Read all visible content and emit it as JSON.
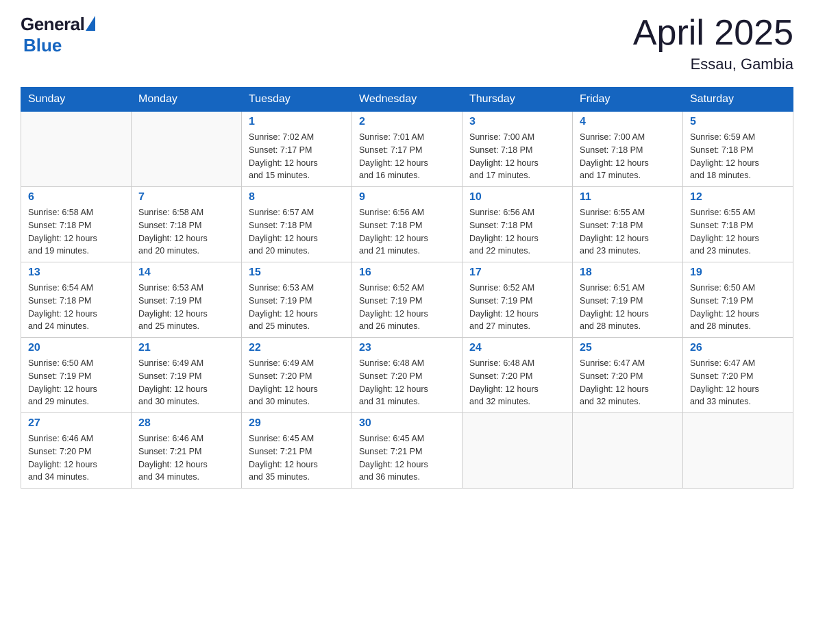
{
  "header": {
    "logo_general": "General",
    "logo_blue": "Blue",
    "month_title": "April 2025",
    "location": "Essau, Gambia"
  },
  "weekdays": [
    "Sunday",
    "Monday",
    "Tuesday",
    "Wednesday",
    "Thursday",
    "Friday",
    "Saturday"
  ],
  "weeks": [
    [
      {
        "day": "",
        "info": ""
      },
      {
        "day": "",
        "info": ""
      },
      {
        "day": "1",
        "info": "Sunrise: 7:02 AM\nSunset: 7:17 PM\nDaylight: 12 hours\nand 15 minutes."
      },
      {
        "day": "2",
        "info": "Sunrise: 7:01 AM\nSunset: 7:17 PM\nDaylight: 12 hours\nand 16 minutes."
      },
      {
        "day": "3",
        "info": "Sunrise: 7:00 AM\nSunset: 7:18 PM\nDaylight: 12 hours\nand 17 minutes."
      },
      {
        "day": "4",
        "info": "Sunrise: 7:00 AM\nSunset: 7:18 PM\nDaylight: 12 hours\nand 17 minutes."
      },
      {
        "day": "5",
        "info": "Sunrise: 6:59 AM\nSunset: 7:18 PM\nDaylight: 12 hours\nand 18 minutes."
      }
    ],
    [
      {
        "day": "6",
        "info": "Sunrise: 6:58 AM\nSunset: 7:18 PM\nDaylight: 12 hours\nand 19 minutes."
      },
      {
        "day": "7",
        "info": "Sunrise: 6:58 AM\nSunset: 7:18 PM\nDaylight: 12 hours\nand 20 minutes."
      },
      {
        "day": "8",
        "info": "Sunrise: 6:57 AM\nSunset: 7:18 PM\nDaylight: 12 hours\nand 20 minutes."
      },
      {
        "day": "9",
        "info": "Sunrise: 6:56 AM\nSunset: 7:18 PM\nDaylight: 12 hours\nand 21 minutes."
      },
      {
        "day": "10",
        "info": "Sunrise: 6:56 AM\nSunset: 7:18 PM\nDaylight: 12 hours\nand 22 minutes."
      },
      {
        "day": "11",
        "info": "Sunrise: 6:55 AM\nSunset: 7:18 PM\nDaylight: 12 hours\nand 23 minutes."
      },
      {
        "day": "12",
        "info": "Sunrise: 6:55 AM\nSunset: 7:18 PM\nDaylight: 12 hours\nand 23 minutes."
      }
    ],
    [
      {
        "day": "13",
        "info": "Sunrise: 6:54 AM\nSunset: 7:18 PM\nDaylight: 12 hours\nand 24 minutes."
      },
      {
        "day": "14",
        "info": "Sunrise: 6:53 AM\nSunset: 7:19 PM\nDaylight: 12 hours\nand 25 minutes."
      },
      {
        "day": "15",
        "info": "Sunrise: 6:53 AM\nSunset: 7:19 PM\nDaylight: 12 hours\nand 25 minutes."
      },
      {
        "day": "16",
        "info": "Sunrise: 6:52 AM\nSunset: 7:19 PM\nDaylight: 12 hours\nand 26 minutes."
      },
      {
        "day": "17",
        "info": "Sunrise: 6:52 AM\nSunset: 7:19 PM\nDaylight: 12 hours\nand 27 minutes."
      },
      {
        "day": "18",
        "info": "Sunrise: 6:51 AM\nSunset: 7:19 PM\nDaylight: 12 hours\nand 28 minutes."
      },
      {
        "day": "19",
        "info": "Sunrise: 6:50 AM\nSunset: 7:19 PM\nDaylight: 12 hours\nand 28 minutes."
      }
    ],
    [
      {
        "day": "20",
        "info": "Sunrise: 6:50 AM\nSunset: 7:19 PM\nDaylight: 12 hours\nand 29 minutes."
      },
      {
        "day": "21",
        "info": "Sunrise: 6:49 AM\nSunset: 7:19 PM\nDaylight: 12 hours\nand 30 minutes."
      },
      {
        "day": "22",
        "info": "Sunrise: 6:49 AM\nSunset: 7:20 PM\nDaylight: 12 hours\nand 30 minutes."
      },
      {
        "day": "23",
        "info": "Sunrise: 6:48 AM\nSunset: 7:20 PM\nDaylight: 12 hours\nand 31 minutes."
      },
      {
        "day": "24",
        "info": "Sunrise: 6:48 AM\nSunset: 7:20 PM\nDaylight: 12 hours\nand 32 minutes."
      },
      {
        "day": "25",
        "info": "Sunrise: 6:47 AM\nSunset: 7:20 PM\nDaylight: 12 hours\nand 32 minutes."
      },
      {
        "day": "26",
        "info": "Sunrise: 6:47 AM\nSunset: 7:20 PM\nDaylight: 12 hours\nand 33 minutes."
      }
    ],
    [
      {
        "day": "27",
        "info": "Sunrise: 6:46 AM\nSunset: 7:20 PM\nDaylight: 12 hours\nand 34 minutes."
      },
      {
        "day": "28",
        "info": "Sunrise: 6:46 AM\nSunset: 7:21 PM\nDaylight: 12 hours\nand 34 minutes."
      },
      {
        "day": "29",
        "info": "Sunrise: 6:45 AM\nSunset: 7:21 PM\nDaylight: 12 hours\nand 35 minutes."
      },
      {
        "day": "30",
        "info": "Sunrise: 6:45 AM\nSunset: 7:21 PM\nDaylight: 12 hours\nand 36 minutes."
      },
      {
        "day": "",
        "info": ""
      },
      {
        "day": "",
        "info": ""
      },
      {
        "day": "",
        "info": ""
      }
    ]
  ]
}
